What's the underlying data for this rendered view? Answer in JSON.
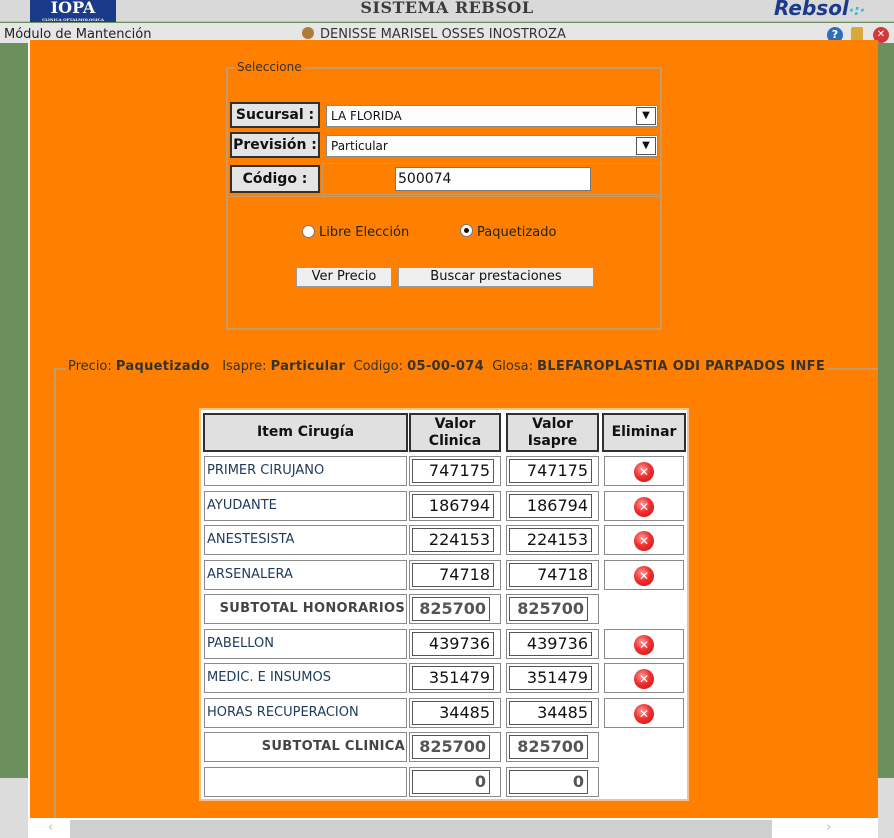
{
  "app": {
    "logo_left": "IOPA",
    "logo_left_sub": "CLINICA OFTALMOLOGICA",
    "title": "SISTEMA REBSOL",
    "logo_right": "Rebsol",
    "module": "Módulo de Mantención",
    "user": "DENISSE MARISEL OSSES INOSTROZA"
  },
  "form": {
    "legend": "Seleccione",
    "sucursal_label": "Sucursal :",
    "sucursal_value": "LA FLORIDA",
    "prevision_label": "Previsión :",
    "prevision_value": "Particular",
    "codigo_label": "Código :",
    "codigo_value": "500074",
    "radio_libre": "Libre Elección",
    "radio_paquetizado": "Paquetizado",
    "radio_selected": "paquetizado",
    "btn_ver_precio": "Ver Precio",
    "btn_buscar": "Buscar prestaciones"
  },
  "info": {
    "precio_label": "Precio:",
    "precio_value": "Paquetizado",
    "isapre_label": "Isapre:",
    "isapre_value": "Particular",
    "codigo_label": "Codigo:",
    "codigo_value": "05-00-074",
    "glosa_label": "Glosa:",
    "glosa_value": "BLEFAROPLASTIA ODI PARPADOS INFE"
  },
  "table": {
    "headers": {
      "item": "Item Cirugía",
      "clinica": "Valor Clinica",
      "isapre": "Valor Isapre",
      "eliminar": "Eliminar"
    },
    "rows": [
      {
        "label": "PRIMER CIRUJANO",
        "clinica": "747175",
        "isapre": "747175",
        "deletable": true
      },
      {
        "label": "AYUDANTE",
        "clinica": "186794",
        "isapre": "186794",
        "deletable": true
      },
      {
        "label": "ANESTESISTA",
        "clinica": "224153",
        "isapre": "224153",
        "deletable": true
      },
      {
        "label": "ARSENALERA",
        "clinica": "74718",
        "isapre": "74718",
        "deletable": true
      },
      {
        "label": "SUBTOTAL HONORARIOS",
        "clinica": "825700",
        "isapre": "825700",
        "subtotal": true
      },
      {
        "label": "PABELLON",
        "clinica": "439736",
        "isapre": "439736",
        "deletable": true
      },
      {
        "label": "MEDIC. E INSUMOS",
        "clinica": "351479",
        "isapre": "351479",
        "deletable": true
      },
      {
        "label": "HORAS RECUPERACION",
        "clinica": "34485",
        "isapre": "34485",
        "deletable": true
      },
      {
        "label": "SUBTOTAL CLINICA",
        "clinica": "825700",
        "isapre": "825700",
        "subtotal": true
      },
      {
        "label": "",
        "clinica": "0",
        "isapre": "0",
        "total": true
      }
    ]
  },
  "colors": {
    "modal_bg": "#ff8000",
    "page_bg": "#6c8f5e",
    "delete_icon": "#e52b2b"
  },
  "icons": {
    "help": "help-icon",
    "lock": "lock-icon",
    "exit": "exit-icon",
    "user": "user-icon",
    "delete": "delete-icon"
  }
}
